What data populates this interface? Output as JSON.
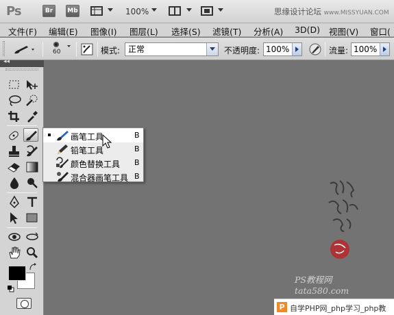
{
  "app": {
    "logo": "Ps",
    "btn_br": "Br",
    "btn_mb": "Mb",
    "zoom": "100%",
    "watermark_top": "思缘设计论坛",
    "watermark_url": "www.MISSYUAN.COM"
  },
  "menu": {
    "items": [
      "文件(F)",
      "编辑(E)",
      "图像(I)",
      "图层(L)",
      "选择(S)",
      "滤镜(T)",
      "分析(A)",
      "3D(D)",
      "视图(V)",
      "窗口("
    ]
  },
  "options": {
    "brush_size": "60",
    "mode_label": "模式:",
    "mode_value": "正常",
    "opacity_label": "不透明度:",
    "opacity_value": "100%",
    "flow_label": "流量:",
    "flow_value": "100%"
  },
  "toolbox": {
    "collapse": "◂◂"
  },
  "flyout": {
    "items": [
      {
        "label": "画笔工具",
        "key": "B"
      },
      {
        "label": "铅笔工具",
        "key": "B"
      },
      {
        "label": "颜色替换工具",
        "key": "B"
      },
      {
        "label": "混合器画笔工具",
        "key": "B"
      }
    ]
  },
  "watermarks": {
    "ps": "PS教程网",
    "url": "tata580.com",
    "bottom": "自学PHP网_php学习_php教"
  },
  "colors": {
    "canvas": "#737373",
    "seal": "#b8282d",
    "php": "#f08a24"
  }
}
